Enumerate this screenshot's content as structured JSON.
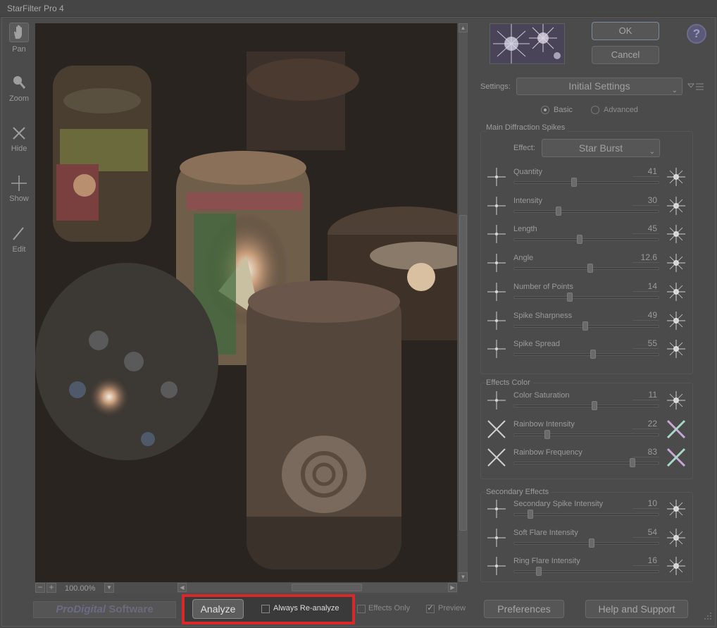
{
  "window": {
    "title": "StarFilter Pro 4"
  },
  "tools": [
    {
      "label": "Pan",
      "icon": "hand-icon"
    },
    {
      "label": "Zoom",
      "icon": "magnifier-icon"
    },
    {
      "label": "Hide",
      "icon": "x-cross-icon"
    },
    {
      "label": "Show",
      "icon": "plus-cross-icon"
    },
    {
      "label": "Edit",
      "icon": "pencil-line-icon"
    }
  ],
  "zoom": {
    "value": "100.00%"
  },
  "bottom": {
    "logo": {
      "part1": "ProDigital",
      "part2": " Software"
    },
    "analyze_label": "Analyze",
    "always_reanalyze_label": "Always Re-analyze",
    "effects_only_label": "Effects Only",
    "preview_label": "Preview",
    "preview_checked": true,
    "preferences_label": "Preferences",
    "help_support_label": "Help and Support"
  },
  "buttons": {
    "ok": "OK",
    "cancel": "Cancel",
    "help": "?"
  },
  "settings": {
    "label": "Settings:",
    "value": "Initial Settings"
  },
  "mode": {
    "basic": "Basic",
    "advanced": "Advanced",
    "selected": "basic"
  },
  "main": {
    "title": "Main Diffraction Spikes",
    "effect_label": "Effect:",
    "effect_value": "Star Burst",
    "sliders": [
      {
        "label": "Quantity",
        "value": "41",
        "pos": 0.41
      },
      {
        "label": "Intensity",
        "value": "30",
        "pos": 0.3
      },
      {
        "label": "Length",
        "value": "45",
        "pos": 0.45
      },
      {
        "label": "Angle",
        "value": "12.6",
        "pos": 0.53
      },
      {
        "label": "Number of Points",
        "value": "14",
        "pos": 0.38
      },
      {
        "label": "Spike Sharpness",
        "value": "49",
        "pos": 0.49
      },
      {
        "label": "Spike Spread",
        "value": "55",
        "pos": 0.55
      }
    ]
  },
  "color": {
    "title": "Effects Color",
    "sliders": [
      {
        "label": "Color Saturation",
        "value": "11",
        "pos": 0.56
      },
      {
        "label": "Rainbow Intensity",
        "value": "22",
        "pos": 0.22
      },
      {
        "label": "Rainbow Frequency",
        "value": "83",
        "pos": 0.83
      }
    ]
  },
  "secondary": {
    "title": "Secondary Effects",
    "sliders": [
      {
        "label": "Secondary Spike Intensity",
        "value": "10",
        "pos": 0.1
      },
      {
        "label": "Soft Flare Intensity",
        "value": "54",
        "pos": 0.54
      },
      {
        "label": "Ring Flare Intensity",
        "value": "16",
        "pos": 0.16
      }
    ]
  },
  "colors": {
    "highlight": "#d8282a",
    "background": "#4b4b4b"
  }
}
